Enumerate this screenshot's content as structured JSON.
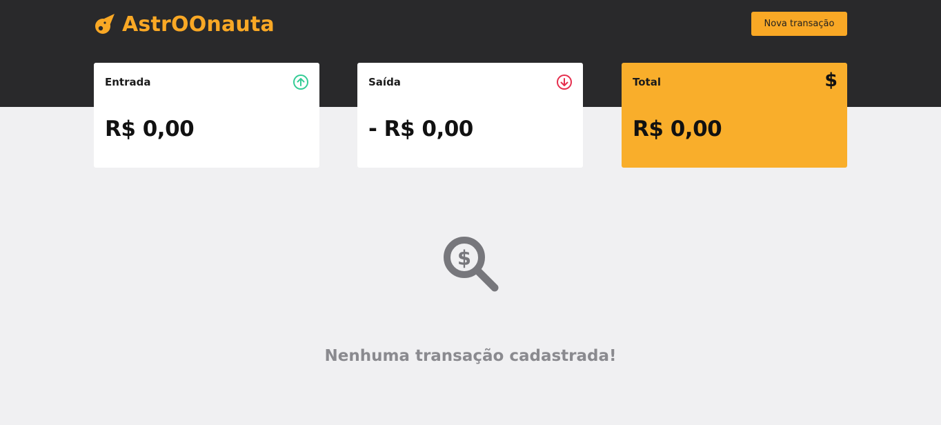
{
  "header": {
    "brand_name": "AstrOOnauta",
    "brand_icon": "comet-icon",
    "new_transaction_label": "Nova transação",
    "background_color": "#29292b",
    "accent_color": "#f9a825"
  },
  "cards": {
    "entrada": {
      "title": "Entrada",
      "value": "R$ 0,00",
      "icon": "arrow-up-circle-icon",
      "icon_color": "#33cc95"
    },
    "saida": {
      "title": "Saída",
      "value": "- R$ 0,00",
      "icon": "arrow-down-circle-icon",
      "icon_color": "#e52e4d"
    },
    "total": {
      "title": "Total",
      "value": "R$ 0,00",
      "icon": "dollar-icon",
      "icon_glyph": "$",
      "background_color": "#f9ae2b"
    }
  },
  "empty_state": {
    "icon": "search-dollar-icon",
    "message": "Nenhuma transação cadastrada!"
  }
}
